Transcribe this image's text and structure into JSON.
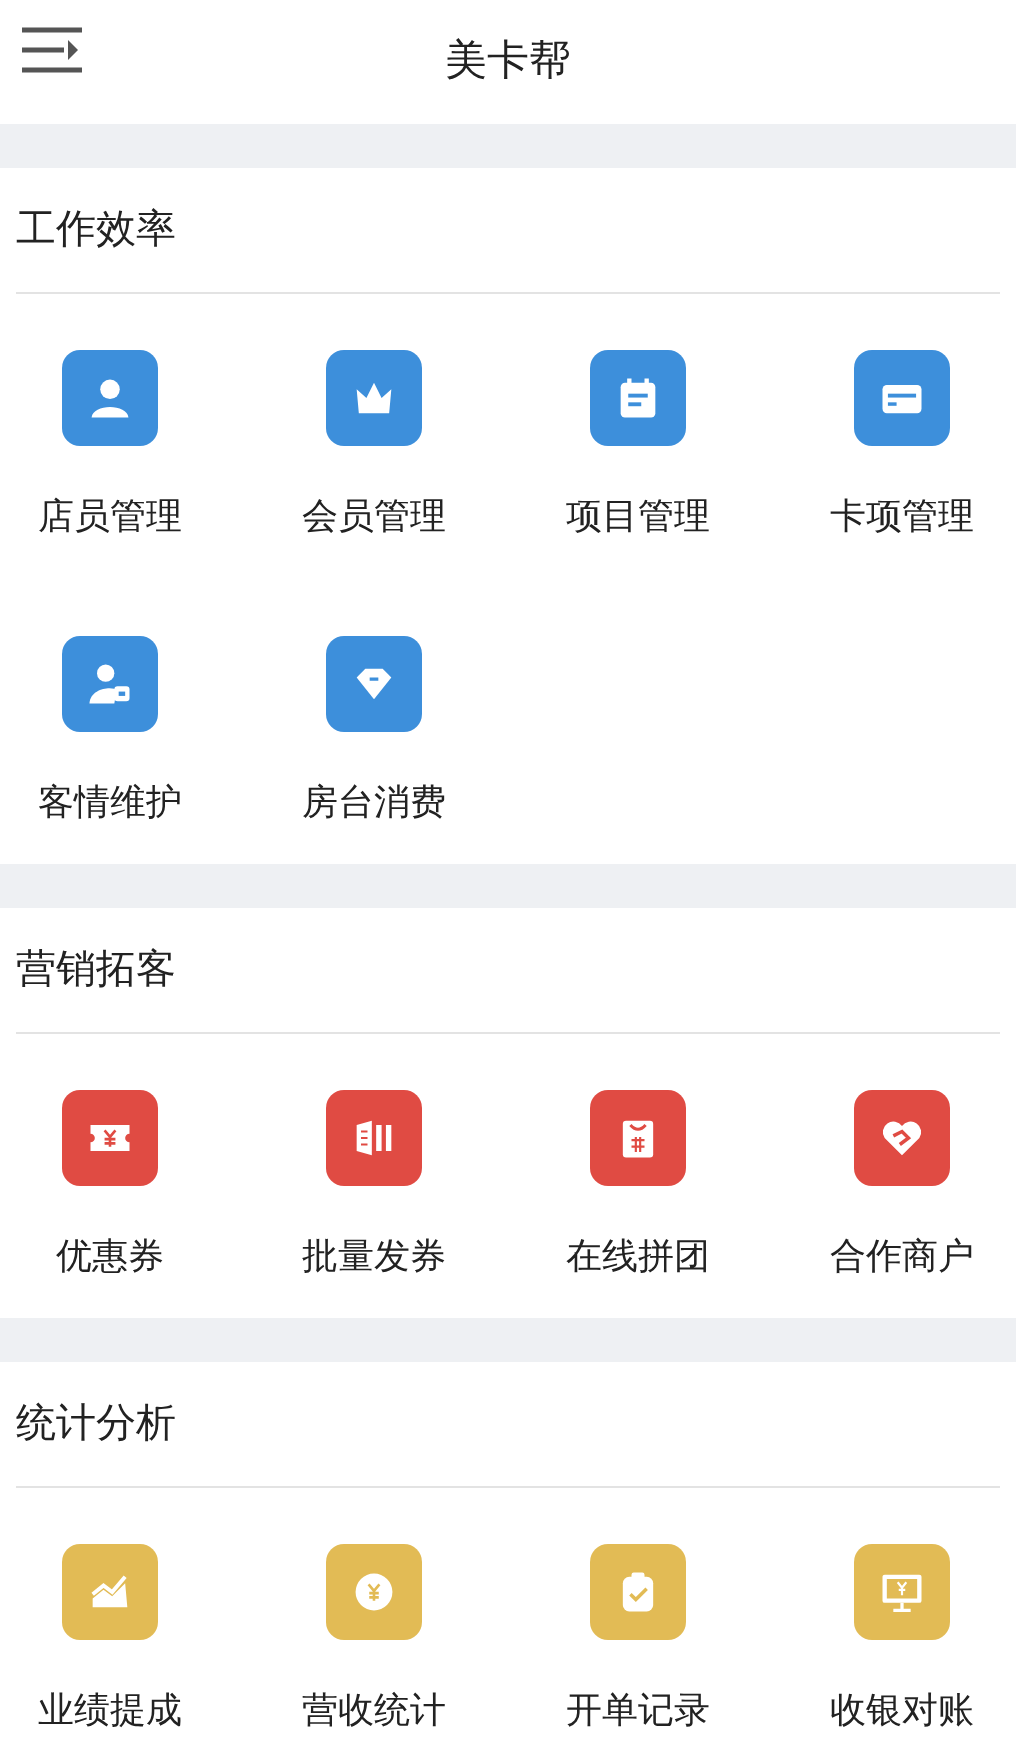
{
  "header": {
    "title": "美卡帮"
  },
  "sections": [
    {
      "title": "工作效率",
      "color": "#3d8fdb",
      "items": [
        {
          "label": "店员管理",
          "kind": "person"
        },
        {
          "label": "会员管理",
          "kind": "crown"
        },
        {
          "label": "项目管理",
          "kind": "calendar"
        },
        {
          "label": "卡项管理",
          "kind": "card"
        },
        {
          "label": "客情维护",
          "kind": "person-care"
        },
        {
          "label": "房台消费",
          "kind": "diamond"
        }
      ]
    },
    {
      "title": "营销拓客",
      "color": "#e04b43",
      "items": [
        {
          "label": "优惠券",
          "kind": "ticket"
        },
        {
          "label": "批量发券",
          "kind": "stack"
        },
        {
          "label": "在线拼团",
          "kind": "bag"
        },
        {
          "label": "合作商户",
          "kind": "heart"
        }
      ]
    },
    {
      "title": "统计分析",
      "color": "#e2bb55",
      "items": [
        {
          "label": "业绩提成",
          "kind": "chart"
        },
        {
          "label": "营收统计",
          "kind": "coin"
        },
        {
          "label": "开单记录",
          "kind": "clipboard"
        },
        {
          "label": "收银对账",
          "kind": "monitor"
        }
      ]
    }
  ]
}
